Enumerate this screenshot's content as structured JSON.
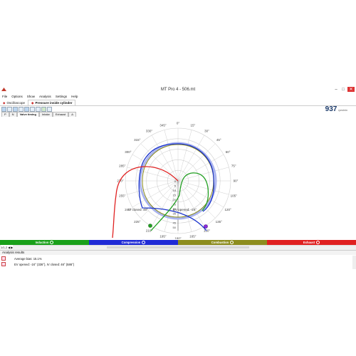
{
  "window": {
    "title": "MT Pro 4 - 506.mt"
  },
  "menu": [
    "File",
    "Options",
    "Show",
    "Analysis",
    "Settings",
    "Help"
  ],
  "top_tabs": [
    "Oscilloscope",
    "Pressure inside cylinder"
  ],
  "counter": {
    "value": "937",
    "unit": "rpm/min"
  },
  "sub_tabs": [
    "P",
    "N",
    "Valve timing",
    "Intake",
    "Exhaust",
    "Δ"
  ],
  "chart": {
    "angle_labels": [
      "0°",
      "15°",
      "30°",
      "45°",
      "60°",
      "75°",
      "90°",
      "105°",
      "120°",
      "135°",
      "150°",
      "165°",
      "180°",
      "195°",
      "210°",
      "225°",
      "240°",
      "255°",
      "270°",
      "285°",
      "300°",
      "315°",
      "330°",
      "345°"
    ],
    "radial_labels": [
      "0",
      "5",
      "10",
      "15",
      "20",
      "25",
      "30",
      "35",
      "40",
      "45",
      "50"
    ],
    "annotations": {
      "iv_closed": "IV closed: 46°",
      "ev_opened": "EV opened: -24°"
    },
    "colors": {
      "blue": "#1a33cc",
      "olive": "#8a8a1a",
      "green": "#22a022",
      "red": "#e02222",
      "halo": "#aab4ee",
      "grid": "#d0d0d0"
    }
  },
  "phases": [
    {
      "label": "Induction",
      "color": "#1aa01a"
    },
    {
      "label": "Compression",
      "color": "#1f2ad6"
    },
    {
      "label": "Combustion",
      "color": "#8d8d1e"
    },
    {
      "label": "Exhaust",
      "color": "#e02020"
    }
  ],
  "page": {
    "current": "1/1-2"
  },
  "analysis": {
    "header": "Analysis results",
    "line1": "Average bias: 15.1%",
    "line2": "EV opened: -24° (336°), IV closed: 46° (586°)"
  }
}
